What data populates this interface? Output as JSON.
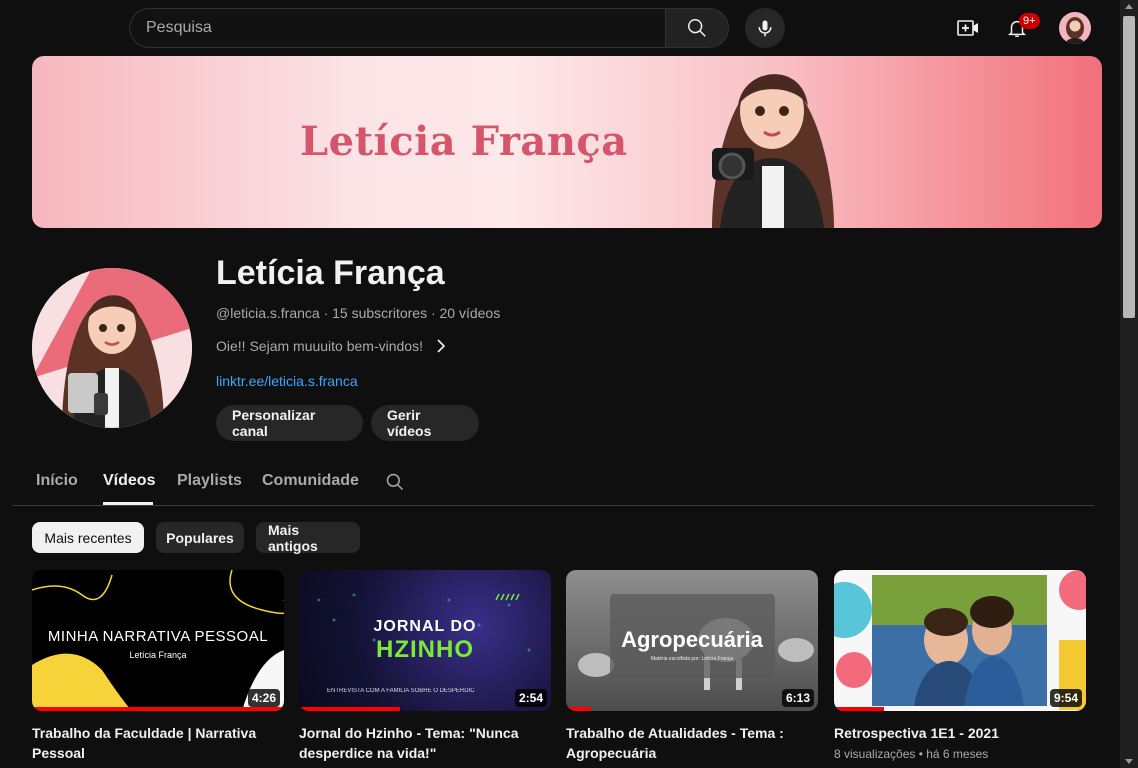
{
  "search": {
    "placeholder": "Pesquisa"
  },
  "header": {
    "notification_count": "9+"
  },
  "banner": {
    "title": "Letícia França"
  },
  "channel": {
    "name": "Letícia França",
    "meta": "@leticia.s.franca · 15 subscritores · 20 vídeos",
    "description": "Oie!! Sejam muuuito bem-vindos!",
    "link": "linktr.ee/leticia.s.franca",
    "customize_label": "Personalizar canal",
    "manage_label": "Gerir vídeos"
  },
  "tabs": [
    {
      "label": "Início"
    },
    {
      "label": "Vídeos"
    },
    {
      "label": "Playlists"
    },
    {
      "label": "Comunidade"
    }
  ],
  "chips": [
    {
      "label": "Mais recentes"
    },
    {
      "label": "Populares"
    },
    {
      "label": "Mais antigos"
    }
  ],
  "videos": [
    {
      "title": "Trabalho da Faculdade | Narrativa Pessoal",
      "duration": "4:26",
      "thumb_text": "MINHA NARRATIVA PESSOAL",
      "thumb_subtext": "Letícia França",
      "progress": 1.0,
      "meta": ""
    },
    {
      "title": "Jornal do Hzinho - Tema: \"Nunca desperdice na vida!\"",
      "duration": "2:54",
      "thumb_text": "JORNAL DO",
      "thumb_text2": "HZINHO",
      "thumb_subtext": "ENTREVISTA COM A FAMÍLIA SOBRE O DESPERDÍC",
      "progress": 0.4,
      "meta": ""
    },
    {
      "title": "Trabalho de Atualidades - Tema : Agropecuária",
      "duration": "6:13",
      "thumb_text": "Agropecuária",
      "thumb_subtext": "Matéria escolhida por: Letícia França",
      "progress": 0.1,
      "meta": ""
    },
    {
      "title": "Retrospectiva 1E1 - 2021",
      "duration": "9:54",
      "progress": 0.2,
      "meta": "8 visualizações • há 6 meses"
    }
  ],
  "colors": {
    "accent_red": "#ff0000",
    "link_blue": "#3ea6ff",
    "background": "#0f0f0f"
  }
}
